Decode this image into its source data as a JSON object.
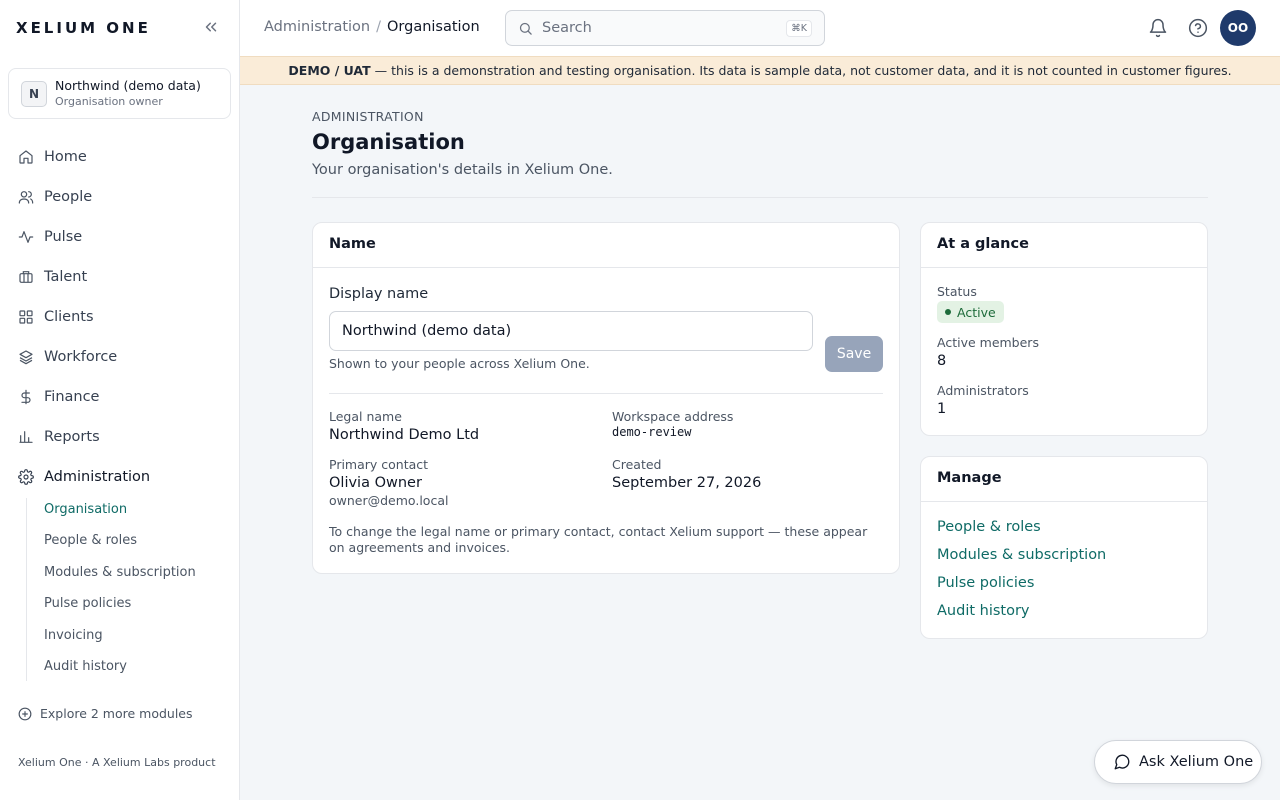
{
  "brand": "XELIUM ONE",
  "org": {
    "initial": "N",
    "name": "Northwind (demo data)",
    "role": "Organisation owner"
  },
  "nav": [
    {
      "label": "Home",
      "icon": "home-icon"
    },
    {
      "label": "People",
      "icon": "people-icon"
    },
    {
      "label": "Pulse",
      "icon": "pulse-icon"
    },
    {
      "label": "Talent",
      "icon": "briefcase-icon"
    },
    {
      "label": "Clients",
      "icon": "grid-icon"
    },
    {
      "label": "Workforce",
      "icon": "layers-icon"
    },
    {
      "label": "Finance",
      "icon": "dollar-icon"
    },
    {
      "label": "Reports",
      "icon": "bar-chart-icon"
    },
    {
      "label": "Administration",
      "icon": "gear-icon"
    }
  ],
  "subnav": [
    {
      "label": "Organisation",
      "active": true
    },
    {
      "label": "People & roles"
    },
    {
      "label": "Modules & subscription"
    },
    {
      "label": "Pulse policies"
    },
    {
      "label": "Invoicing"
    },
    {
      "label": "Audit history"
    }
  ],
  "explore": "Explore 2 more modules",
  "footer": "Xelium One · A Xelium Labs product",
  "breadcrumb": {
    "parent": "Administration",
    "sep": "/",
    "current": "Organisation"
  },
  "search": {
    "placeholder": "Search",
    "shortcut": "⌘K"
  },
  "user_initials": "OO",
  "banner": {
    "bold": "DEMO / UAT",
    "text": " — this is a demonstration and testing organisation. Its data is sample data, not customer data, and it is not counted in customer figures."
  },
  "page": {
    "eyebrow": "ADMINISTRATION",
    "title": "Organisation",
    "subtitle": "Your organisation's details in Xelium One."
  },
  "name_card": {
    "title": "Name",
    "display_label": "Display name",
    "display_value": "Northwind (demo data)",
    "save": "Save",
    "help": "Shown to your people across Xelium One.",
    "legal_label": "Legal name",
    "legal_value": "Northwind Demo Ltd",
    "workspace_label": "Workspace address",
    "workspace_value": "demo-review",
    "contact_label": "Primary contact",
    "contact_name": "Olivia Owner",
    "contact_email": "owner@demo.local",
    "created_label": "Created",
    "created_value": "September 27, 2026",
    "note": "To change the legal name or primary contact, contact Xelium support — these appear on agreements and invoices."
  },
  "glance": {
    "title": "At a glance",
    "status_label": "Status",
    "status_value": "Active",
    "members_label": "Active members",
    "members_value": "8",
    "admins_label": "Administrators",
    "admins_value": "1"
  },
  "manage": {
    "title": "Manage",
    "links": [
      "People & roles",
      "Modules & subscription",
      "Pulse policies",
      "Audit history"
    ]
  },
  "ask": "Ask Xelium One",
  "colors": {
    "accent": "#0f6b66",
    "avatar": "#1f3a6b",
    "banner": "#faecd8",
    "status": "#1d6b3a"
  }
}
